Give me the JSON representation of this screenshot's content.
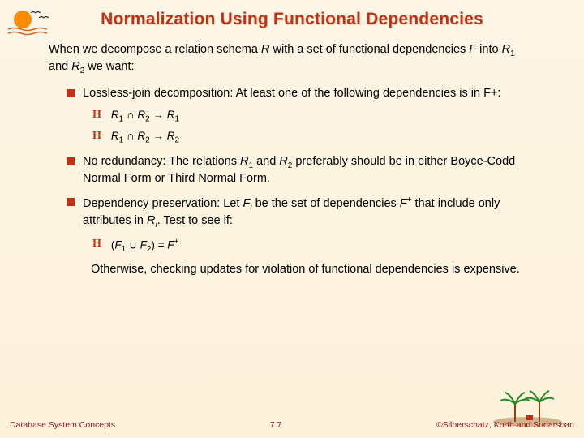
{
  "title": "Normalization Using Functional Dependencies",
  "intro": {
    "part1": "When we decompose a relation schema ",
    "R": "R",
    "part2": " with a set of functional dependencies ",
    "F": "F",
    "part3": " into ",
    "R1": "R",
    "sub1": "1",
    "part4": " and ",
    "R2": "R",
    "sub2": "2",
    "part5": " we want:"
  },
  "b1": {
    "text": "Lossless-join decomposition:  At least one of the following dependencies is in F+:"
  },
  "dep1": {
    "r1": "R",
    "s1": "1",
    "cap": " ∩ ",
    "r2": "R",
    "s2": "2",
    "arrow": " → ",
    "r3": "R",
    "s3": "1"
  },
  "dep2": {
    "r1": "R",
    "s1": "1",
    "cap": " ∩ ",
    "r2": "R",
    "s2": "2",
    "arrow": " → ",
    "r3": "R",
    "s3": "2"
  },
  "b2": {
    "pre": "No redundancy:  The relations ",
    "r1": "R",
    "s1": "1",
    "mid": " and ",
    "r2": "R",
    "s2": "2",
    "post": " preferably should be in either Boyce-Codd Normal Form or Third Normal Form."
  },
  "b3": {
    "pre": "Dependency preservation: Let ",
    "F": "F",
    "si": "i",
    "mid1": " be the set of dependencies ",
    "F2": "F",
    "sup": "+",
    "mid2": " that include only attributes in ",
    "R": "R",
    "si2": "i",
    "post": ". Test to see if:"
  },
  "dep3": {
    "open": "(",
    "f1": "F",
    "s1": "1",
    "cup": " ∪ ",
    "f2": "F",
    "s2": "2",
    "close": ")",
    "eq": " = ",
    "f3": "F",
    "sup": "+"
  },
  "otherwise": "Otherwise, checking updates for violation of functional dependencies is expensive.",
  "footer": {
    "left": "Database System Concepts",
    "center": "7.7",
    "right": "©Silberschatz, Korth and Sudarshan"
  }
}
